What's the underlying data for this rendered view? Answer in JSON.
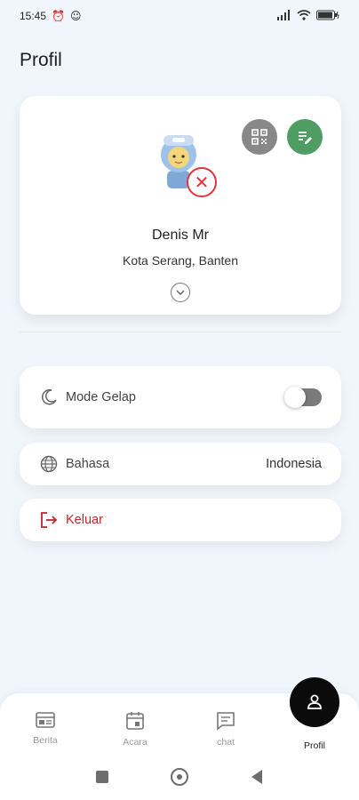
{
  "status_bar": {
    "time": "15:45"
  },
  "page": {
    "title": "Profil"
  },
  "profile": {
    "name": "Denis Mr",
    "location": "Kota Serang, Banten"
  },
  "settings": {
    "dark_mode_label": "Mode Gelap",
    "dark_mode_enabled": false,
    "language_label": "Bahasa",
    "language_value": "Indonesia",
    "logout_label": "Keluar"
  },
  "colors": {
    "edit_button": "#4f9d62",
    "qr_button": "#888888",
    "logout": "#c0262d",
    "badge_x": "#e0343b"
  },
  "bottom_nav": {
    "items": [
      {
        "label": "Berita",
        "icon": "newspaper-icon"
      },
      {
        "label": "Acara",
        "icon": "calendar-icon"
      },
      {
        "label": "chat",
        "icon": "chat-icon"
      },
      {
        "label": "Profil",
        "icon": "person-icon",
        "active": true
      }
    ]
  }
}
